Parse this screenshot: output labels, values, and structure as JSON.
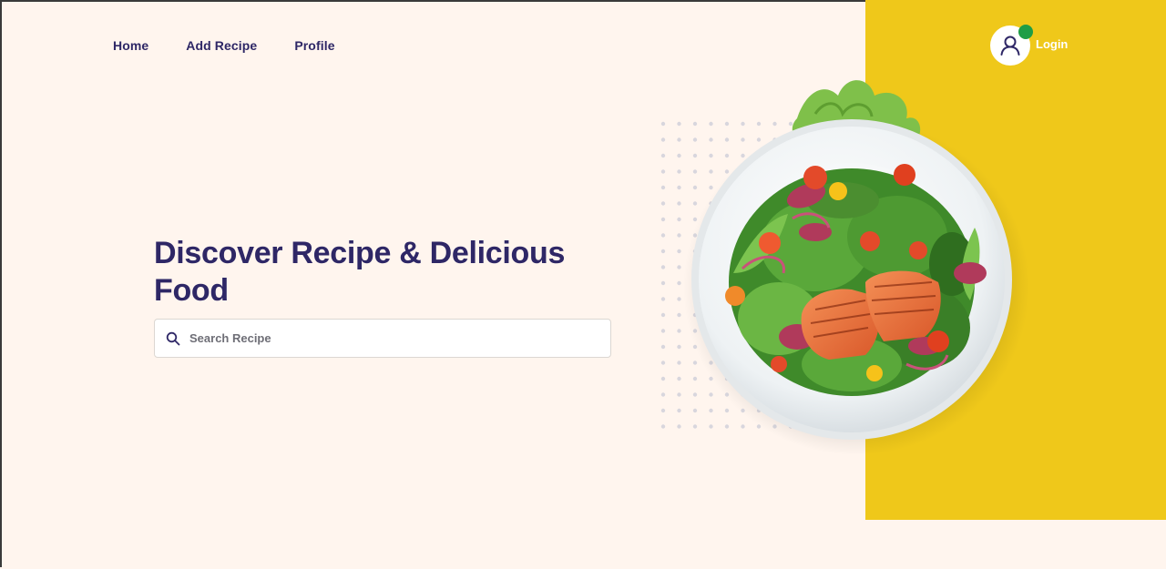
{
  "nav": {
    "items": [
      {
        "label": "Home"
      },
      {
        "label": "Add Recipe"
      },
      {
        "label": "Profile"
      }
    ]
  },
  "login": {
    "label": "Login",
    "avatar_icon": "user-icon",
    "status_color": "#1f9d46"
  },
  "hero": {
    "title": "Discover Recipe & Delicious Food"
  },
  "search": {
    "placeholder": "Search Recipe",
    "value": "",
    "icon": "search-icon"
  },
  "colors": {
    "background": "#fff5ee",
    "accent_panel": "#efc81a",
    "primary_text": "#2e2766"
  },
  "hero_image": {
    "icon": "salad-plate-image"
  }
}
